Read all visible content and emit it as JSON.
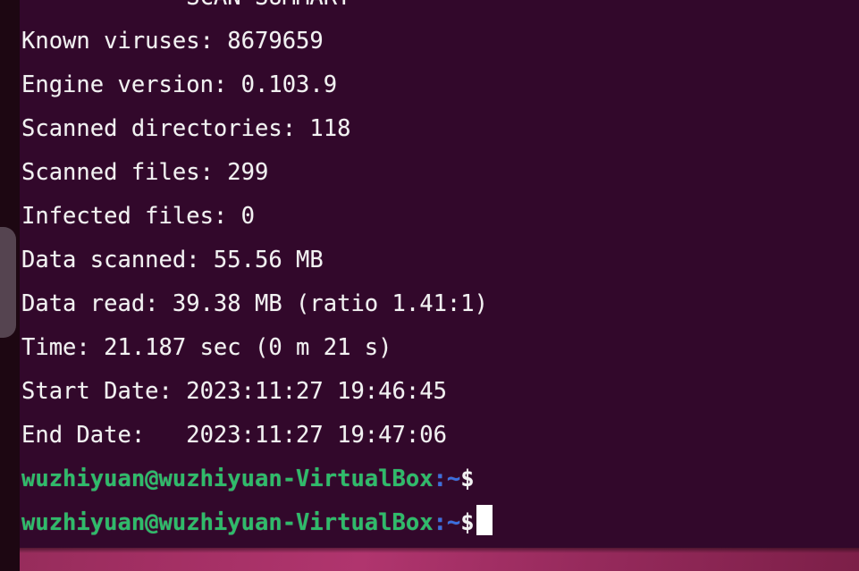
{
  "window": {
    "app": "terminal",
    "background_color": "#32082b",
    "foreground_color": "#f2f2f2"
  },
  "desktop": {
    "wallpaper_color": "#a22f63",
    "dock_background_color": "#1d0712",
    "dock_icon_color": "#554450"
  },
  "terminal": {
    "lines": [
      {
        "name": "scan-summary-header",
        "text": "----------- SCAN SUMMARY -----------"
      },
      {
        "name": "known-viruses",
        "text": "Known viruses: 8679659"
      },
      {
        "name": "engine-version",
        "text": "Engine version: 0.103.9"
      },
      {
        "name": "scanned-directories",
        "text": "Scanned directories: 118"
      },
      {
        "name": "scanned-files",
        "text": "Scanned files: 299"
      },
      {
        "name": "infected-files",
        "text": "Infected files: 0"
      },
      {
        "name": "data-scanned",
        "text": "Data scanned: 55.56 MB"
      },
      {
        "name": "data-read",
        "text": "Data read: 39.38 MB (ratio 1.41:1)"
      },
      {
        "name": "elapsed-time",
        "text": "Time: 21.187 sec (0 m 21 s)"
      },
      {
        "name": "start-date",
        "text": "Start Date: 2023:11:27 19:46:45"
      },
      {
        "name": "end-date",
        "text": "End Date:   2023:11:27 19:47:06"
      }
    ],
    "scan_summary": {
      "title": "SCAN SUMMARY",
      "known_viruses": "8679659",
      "engine_version": "0.103.9",
      "scanned_directories": "118",
      "scanned_files": "299",
      "infected_files": "0",
      "data_scanned": "55.56 MB",
      "data_read": "39.38 MB (ratio 1.41:1)",
      "time": "21.187 sec (0 m 21 s)",
      "start_date": "2023:11:27 19:46:45",
      "end_date": "2023:11:27 19:47:06"
    },
    "prompt": {
      "user_host": "wuzhiyuan@wuzhiyuan-VirtualBox",
      "path": ":~",
      "symbol": "$",
      "user_color": "#2fbb6a",
      "path_color": "#3a6fe0",
      "symbol_color": "#f2f2f2"
    },
    "prompt_lines": [
      {
        "name": "prompt-line-previous",
        "has_cursor": false
      },
      {
        "name": "prompt-line-active",
        "has_cursor": true
      }
    ],
    "command_input": {
      "value": "",
      "cursor_color": "#ffffff"
    }
  }
}
